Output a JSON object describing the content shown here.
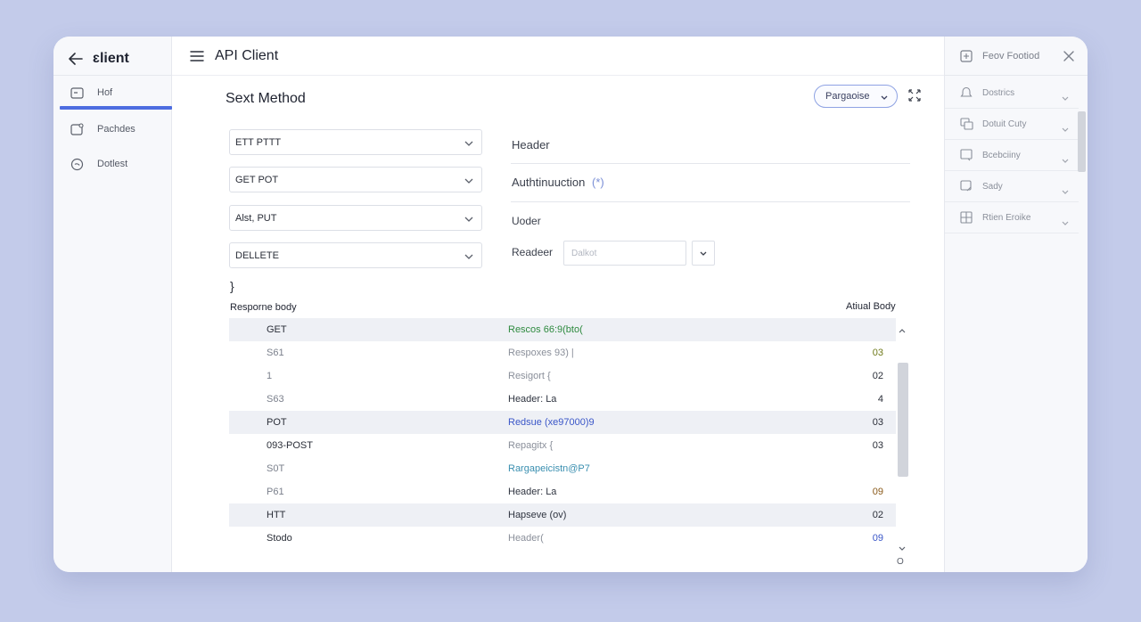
{
  "sidebar": {
    "title": "ɛlient",
    "items": [
      {
        "label": "Hof",
        "icon": "folder-icon"
      },
      {
        "label": "Pachdes",
        "icon": "package-icon"
      },
      {
        "label": "Dotlest",
        "icon": "globe-icon"
      }
    ]
  },
  "header": {
    "title": "API Client"
  },
  "main": {
    "section_title": "Sext Method",
    "purpose_button": "Pargaoise",
    "method_selects": [
      {
        "value": "ETT  PTTT"
      },
      {
        "value": "GET  POT"
      },
      {
        "value": "Alst,   PUT"
      },
      {
        "value": "DELLETE"
      }
    ],
    "request_panel": {
      "header_label": "Header",
      "auth_label": "Authtinuuction",
      "auth_hint": "(*)",
      "under_label": "Uoder",
      "reader_label": "Readeer",
      "reader_placeholder": "Dalkot"
    },
    "brace": "}",
    "response_body_label": "Resporne body",
    "actual_body_label": "Atiual Body",
    "rows": [
      {
        "method": "GET",
        "body": "Rescos 66:9(bto(",
        "code": ""
      },
      {
        "method": "S61",
        "body": "Respoxes 93) |",
        "code": "03"
      },
      {
        "method": "1",
        "body": "Resigort {",
        "code": "02"
      },
      {
        "method": "S63",
        "body": "Header: La",
        "code": "4"
      },
      {
        "method": "POT",
        "body": "Redsue (xe97000)9",
        "code": "03"
      },
      {
        "method": "093-POST",
        "body": "Repagitx {",
        "code": "03"
      },
      {
        "method": "S0T",
        "body": "Rargapeicistn@P7",
        "code": ""
      },
      {
        "method": "P61",
        "body": "Header: La",
        "code": "09"
      },
      {
        "method": "HTT",
        "body": "Hapseve (ov)",
        "code": "02"
      },
      {
        "method": "Stodo",
        "body": "Header(",
        "code": "09"
      }
    ],
    "bottom_glyph": "O"
  },
  "right_panel": {
    "title": "Feov Footiod",
    "items": [
      {
        "label": "Dostrics",
        "icon": "bell-icon"
      },
      {
        "label": "Dotuit Cuty",
        "icon": "copy-icon"
      },
      {
        "label": "Bcebciiny",
        "icon": "monitor-icon"
      },
      {
        "label": "Sady",
        "icon": "edit-icon"
      },
      {
        "label": "Rtien Eroike",
        "icon": "grid-icon"
      }
    ]
  },
  "colors": {
    "accent": "#4d6de0",
    "background": "#c3cbea",
    "green_text": "#2e8a3f",
    "blue_text": "#3a56c8"
  }
}
